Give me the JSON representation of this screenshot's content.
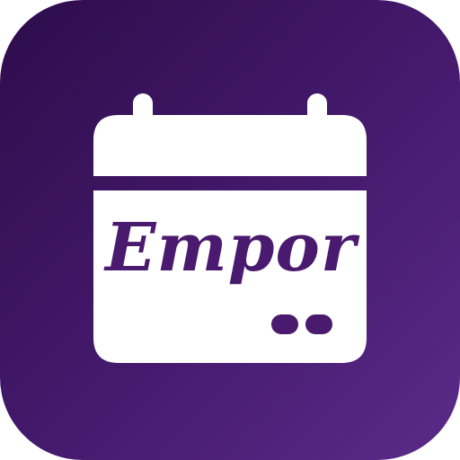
{
  "app": {
    "wordmark": "Empor"
  },
  "icons": {
    "calendar": "calendar-icon",
    "dots": "dots-icon"
  },
  "colors": {
    "background_start": "#2e0c4a",
    "background_end": "#5b2a89",
    "calendar_fill": "#ffffff",
    "accent": "#4a1a6e"
  }
}
